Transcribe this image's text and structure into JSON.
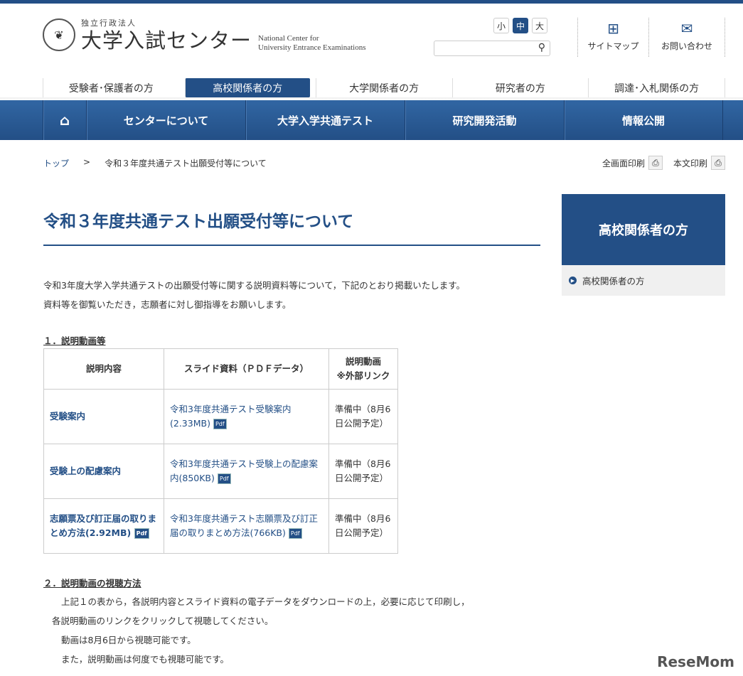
{
  "header": {
    "org_type": "独立行政法人",
    "org_name": "大学入試センター",
    "org_en_1": "National Center for",
    "org_en_2": "University Entrance Examinations",
    "font_sizes": [
      "小",
      "中",
      "大"
    ],
    "search_placeholder": "",
    "sitemap": "サイトマップ",
    "contact": "お問い合わせ"
  },
  "audience_nav": [
    "受験者･保護者の方",
    "高校関係者の方",
    "大学関係者の方",
    "研究者の方",
    "調達･入札関係の方"
  ],
  "main_nav": [
    "センターについて",
    "大学入学共通テスト",
    "研究開発活動",
    "情報公開"
  ],
  "breadcrumb": {
    "top": "トップ",
    "sep": ">",
    "current": "令和３年度共通テスト出願受付等について"
  },
  "print": {
    "full": "全画面印刷",
    "body": "本文印刷"
  },
  "page": {
    "title": "令和３年度共通テスト出願受付等について",
    "intro_1": "令和3年度大学入学共通テストの出願受付等に関する説明資料等について，下記のとおり掲載いたします。",
    "intro_2": "資料等を御覧いただき，志願者に対し御指導をお願いします。",
    "section1": "１．説明動画等",
    "table": {
      "headers": [
        "説明内容",
        "スライド資料（ＰＤＦデータ）",
        "説明動画",
        "※外部リンク"
      ],
      "rows": [
        {
          "topic": "受験案内",
          "slide": "令和3年度共通テスト受験案内(2.33MB)",
          "video": "準備中（8月6日公開予定）"
        },
        {
          "topic": "受験上の配慮案内",
          "slide": "令和3年度共通テスト受験上の配慮案内(850KB)",
          "video": "準備中（8月6日公開予定）"
        },
        {
          "topic": "志願票及び訂正届の取りまとめ方法(2.92MB)",
          "slide": "令和3年度共通テスト志願票及び訂正届の取りまとめ方法(766KB)",
          "video": "準備中（8月6日公開予定）"
        }
      ]
    },
    "pdf_label": "Pdf",
    "section2": "２．説明動画の視聴方法",
    "body_1": "上記１の表から，各説明内容とスライド資料の電子データをダウンロードの上，必要に応じて印刷し，",
    "body_2": "各説明動画のリンクをクリックして視聴してください。",
    "body_3": "動画は8月6日から視聴可能です。",
    "body_4": "また，説明動画は何度でも視聴可能です。"
  },
  "sidebar": {
    "heading": "高校関係者の方",
    "item": "高校関係者の方"
  },
  "watermark": "ReseMom",
  "colors": {
    "brand": "#234f86"
  }
}
